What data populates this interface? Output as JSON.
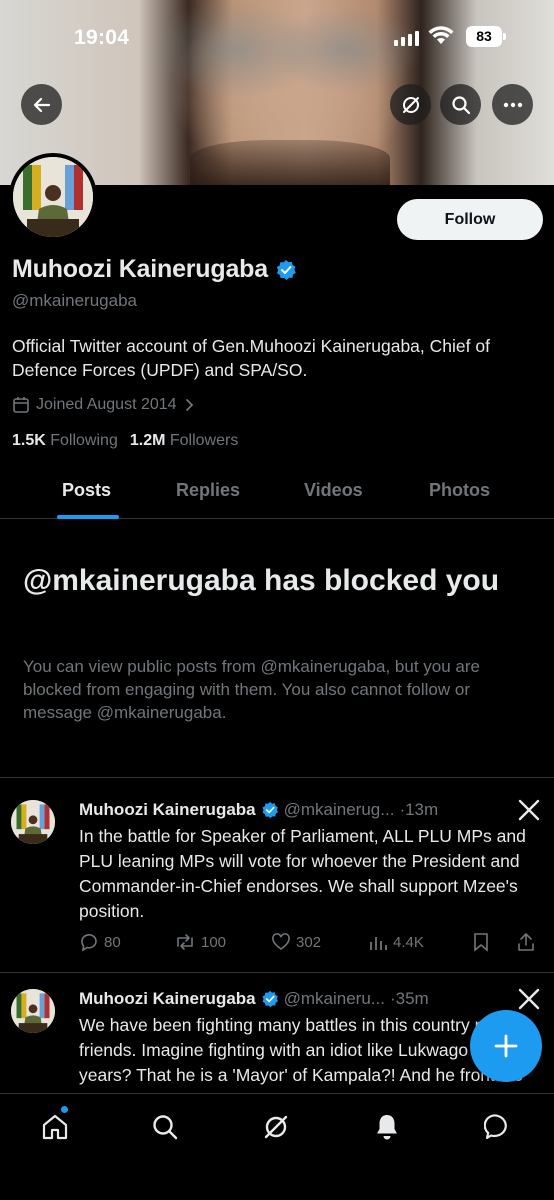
{
  "status_bar": {
    "time": "19:04",
    "battery": "83"
  },
  "profile": {
    "display_name": "Muhoozi Kainerugaba",
    "handle": "@mkainerugaba",
    "bio": "Official Twitter account of Gen.Muhoozi Kainerugaba, Chief of Defence Forces (UPDF) and SPA/SO.",
    "joined": "Joined August 2014",
    "following_count": "1.5K",
    "following_label": "Following",
    "followers_count": "1.2M",
    "followers_label": "Followers",
    "follow_label": "Follow"
  },
  "tabs": [
    {
      "label": "Posts",
      "active": true
    },
    {
      "label": "Replies",
      "active": false
    },
    {
      "label": "Videos",
      "active": false
    },
    {
      "label": "Photos",
      "active": false
    }
  ],
  "blocked": {
    "title": "@mkainerugaba has blocked you",
    "message": "You can view public posts from @mkainerugaba, but you are blocked from engaging with them. You also cannot follow or message @mkainerugaba."
  },
  "posts": [
    {
      "name": "Muhoozi Kainerugaba",
      "handle": "@mkainerug...",
      "time": "·13m",
      "text": "In the battle for Speaker of Parliament, ALL PLU MPs and PLU leaning MPs will vote for whoever the President and Commander-in-Chief endorses. We shall support Mzee's position.",
      "replies": "80",
      "reposts": "100",
      "likes": "302",
      "views": "4.4K"
    },
    {
      "name": "Muhoozi Kainerugaba",
      "handle": "@mkaineru...",
      "time": "·35m",
      "text": "We have been fighting many battles in this country my friends. Imagine fighting with an idiot like Lukwago for 25 years? That he is a 'Mayor' of Kampala?! And he fronts to millions of citizens of"
    }
  ],
  "icons": {
    "verified": "verified-badge-icon",
    "accent": "#1d9bf0"
  }
}
